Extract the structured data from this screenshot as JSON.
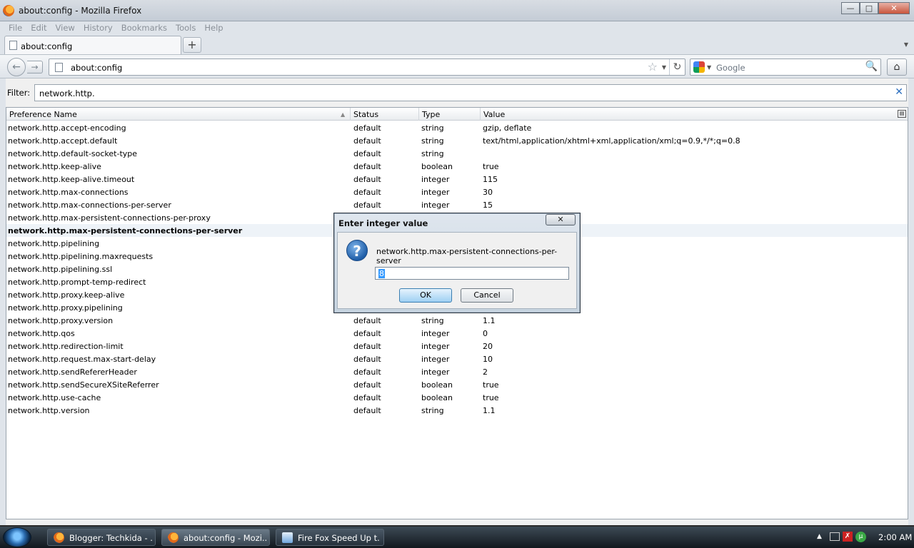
{
  "window": {
    "title": "about:config - Mozilla Firefox"
  },
  "menu": [
    "File",
    "Edit",
    "View",
    "History",
    "Bookmarks",
    "Tools",
    "Help"
  ],
  "tab": {
    "label": "about:config"
  },
  "nav": {
    "url": "about:config",
    "search_placeholder": "Google"
  },
  "filter": {
    "label": "Filter:",
    "value": "network.http."
  },
  "columns": {
    "name": "Preference Name",
    "status": "Status",
    "type": "Type",
    "value": "Value"
  },
  "rows": [
    {
      "name": "network.http.accept-encoding",
      "status": "default",
      "type": "string",
      "value": "gzip, deflate"
    },
    {
      "name": "network.http.accept.default",
      "status": "default",
      "type": "string",
      "value": "text/html,application/xhtml+xml,application/xml;q=0.9,*/*;q=0.8"
    },
    {
      "name": "network.http.default-socket-type",
      "status": "default",
      "type": "string",
      "value": ""
    },
    {
      "name": "network.http.keep-alive",
      "status": "default",
      "type": "boolean",
      "value": "true"
    },
    {
      "name": "network.http.keep-alive.timeout",
      "status": "default",
      "type": "integer",
      "value": "115"
    },
    {
      "name": "network.http.max-connections",
      "status": "default",
      "type": "integer",
      "value": "30"
    },
    {
      "name": "network.http.max-connections-per-server",
      "status": "default",
      "type": "integer",
      "value": "15"
    },
    {
      "name": "network.http.max-persistent-connections-per-proxy",
      "status": "",
      "type": "",
      "value": ""
    },
    {
      "name": "network.http.max-persistent-connections-per-server",
      "status": "",
      "type": "",
      "value": "",
      "modified": true,
      "selected": true
    },
    {
      "name": "network.http.pipelining",
      "status": "",
      "type": "",
      "value": ""
    },
    {
      "name": "network.http.pipelining.maxrequests",
      "status": "",
      "type": "",
      "value": ""
    },
    {
      "name": "network.http.pipelining.ssl",
      "status": "",
      "type": "",
      "value": ""
    },
    {
      "name": "network.http.prompt-temp-redirect",
      "status": "",
      "type": "",
      "value": ""
    },
    {
      "name": "network.http.proxy.keep-alive",
      "status": "",
      "type": "",
      "value": ""
    },
    {
      "name": "network.http.proxy.pipelining",
      "status": "",
      "type": "",
      "value": ""
    },
    {
      "name": "network.http.proxy.version",
      "status": "default",
      "type": "string",
      "value": "1.1"
    },
    {
      "name": "network.http.qos",
      "status": "default",
      "type": "integer",
      "value": "0"
    },
    {
      "name": "network.http.redirection-limit",
      "status": "default",
      "type": "integer",
      "value": "20"
    },
    {
      "name": "network.http.request.max-start-delay",
      "status": "default",
      "type": "integer",
      "value": "10"
    },
    {
      "name": "network.http.sendRefererHeader",
      "status": "default",
      "type": "integer",
      "value": "2"
    },
    {
      "name": "network.http.sendSecureXSiteReferrer",
      "status": "default",
      "type": "boolean",
      "value": "true"
    },
    {
      "name": "network.http.use-cache",
      "status": "default",
      "type": "boolean",
      "value": "true"
    },
    {
      "name": "network.http.version",
      "status": "default",
      "type": "string",
      "value": "1.1"
    }
  ],
  "dialog": {
    "title": "Enter integer value",
    "message": "network.http.max-persistent-connections-per-server",
    "input_value": "8",
    "ok": "OK",
    "cancel": "Cancel"
  },
  "taskbar": {
    "items": [
      {
        "label": "Blogger: Techkida - ...",
        "icon": "firefox-icon"
      },
      {
        "label": "about:config - Mozi...",
        "icon": "firefox-icon",
        "active": true
      },
      {
        "label": "Fire Fox Speed Up t...",
        "icon": "document-icon"
      }
    ],
    "clock": "2:00 AM"
  }
}
